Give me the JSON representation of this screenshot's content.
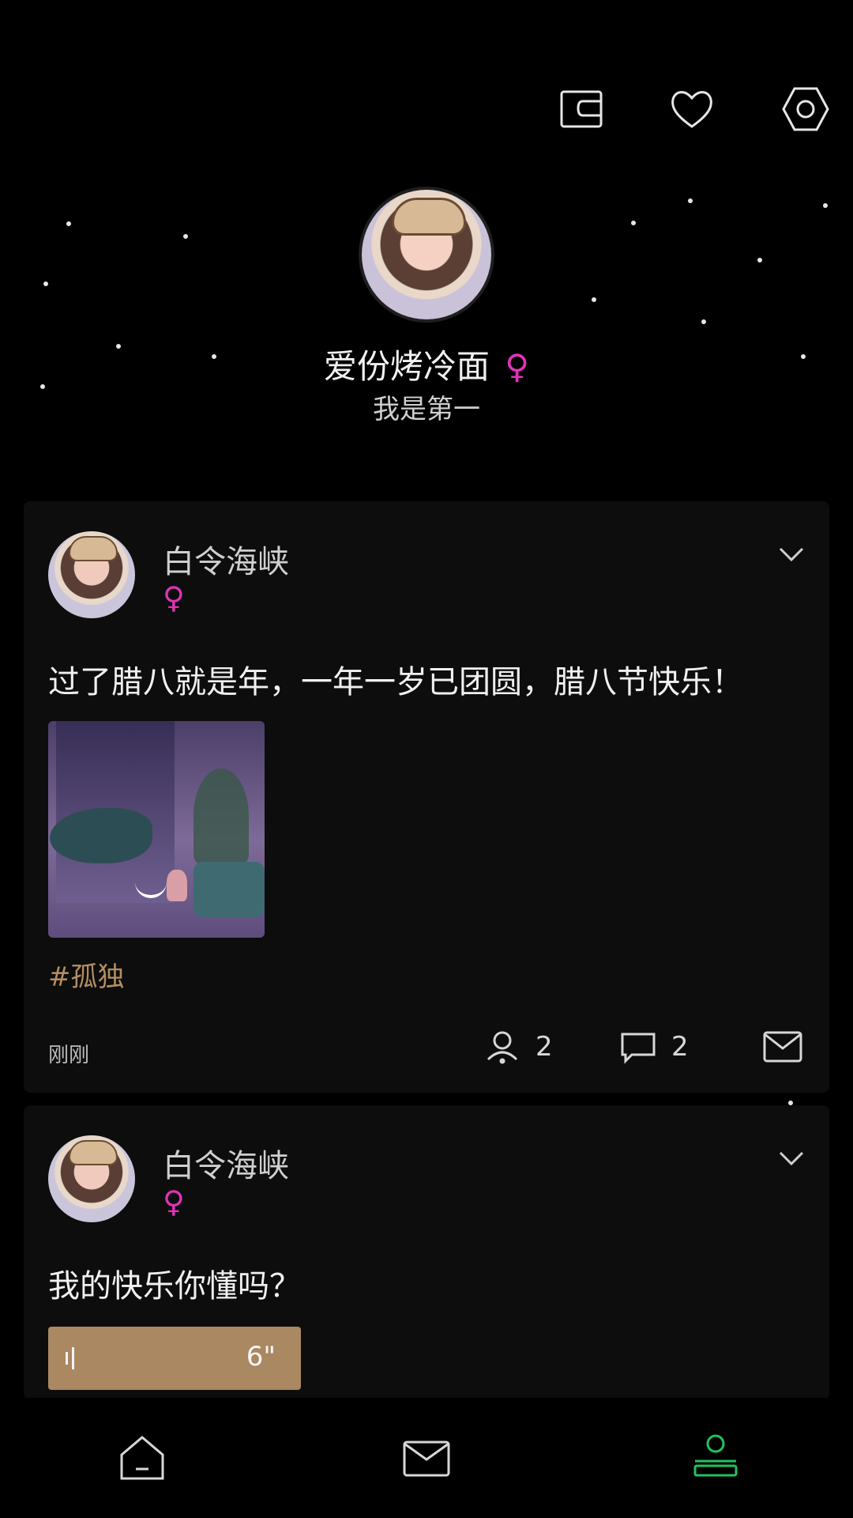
{
  "header": {
    "icons": [
      "wallet-icon",
      "heart-icon",
      "settings-icon"
    ]
  },
  "profile": {
    "name": "爱份烤冷面",
    "gender_symbol": "♀",
    "bio": "我是第一"
  },
  "posts": [
    {
      "author": "白令海峡",
      "gender_symbol": "♀",
      "text": "过了腊八就是年，一年一岁已团圆，腊八节快乐！",
      "topic": "#孤独",
      "time": "刚刚",
      "likes": "2",
      "comments": "2"
    },
    {
      "author": "白令海峡",
      "gender_symbol": "♀",
      "text": "我的快乐你懂吗？",
      "voice_duration": "6\""
    }
  ],
  "bottom_nav": {
    "items": [
      "home-icon",
      "message-icon",
      "profile-icon"
    ],
    "active": "profile-icon"
  },
  "colors": {
    "background": "#000000",
    "card": "#0d0d0d",
    "female": "#e033b8",
    "accent_gold": "#a98862",
    "active_green": "#23c05f"
  }
}
